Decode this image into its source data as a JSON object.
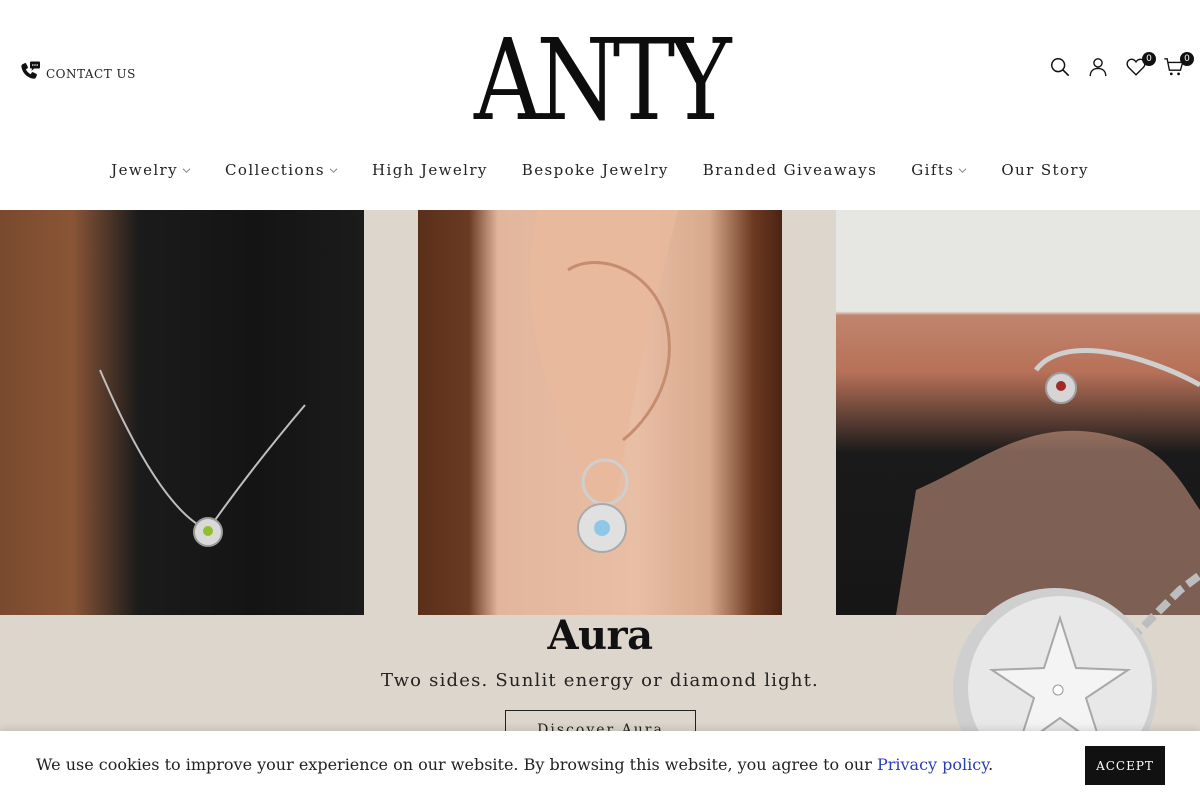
{
  "header": {
    "contact_label": "CONTACT US",
    "logo_text": "ANTY",
    "wishlist_count": "0",
    "cart_count": "0"
  },
  "icons": {
    "contact": "phone-chat-icon",
    "search": "search-icon",
    "account": "user-icon",
    "wishlist": "heart-icon",
    "cart": "cart-icon",
    "dropdown": "chevron-down-icon"
  },
  "nav": {
    "items": [
      {
        "label": "Jewelry",
        "has_dropdown": true
      },
      {
        "label": "Collections",
        "has_dropdown": true
      },
      {
        "label": "High Jewelry",
        "has_dropdown": false
      },
      {
        "label": "Bespoke Jewelry",
        "has_dropdown": false
      },
      {
        "label": "Branded Giveaways",
        "has_dropdown": false
      },
      {
        "label": "Gifts",
        "has_dropdown": true
      },
      {
        "label": "Our Story",
        "has_dropdown": false
      }
    ]
  },
  "hero": {
    "title": "Aura",
    "subtitle": "Two sides. Sunlit energy or diamond light.",
    "button_label": "Discover Aura"
  },
  "cookie": {
    "text": "We use cookies to improve your experience on our website. By browsing this website, you agree to our",
    "link_label": "Privacy policy",
    "period": ".",
    "accept_label": "ACCEPT"
  },
  "colors": {
    "hero_background": "#dcd6cc",
    "accent_dark": "#111111",
    "link": "#2a3fb0"
  }
}
